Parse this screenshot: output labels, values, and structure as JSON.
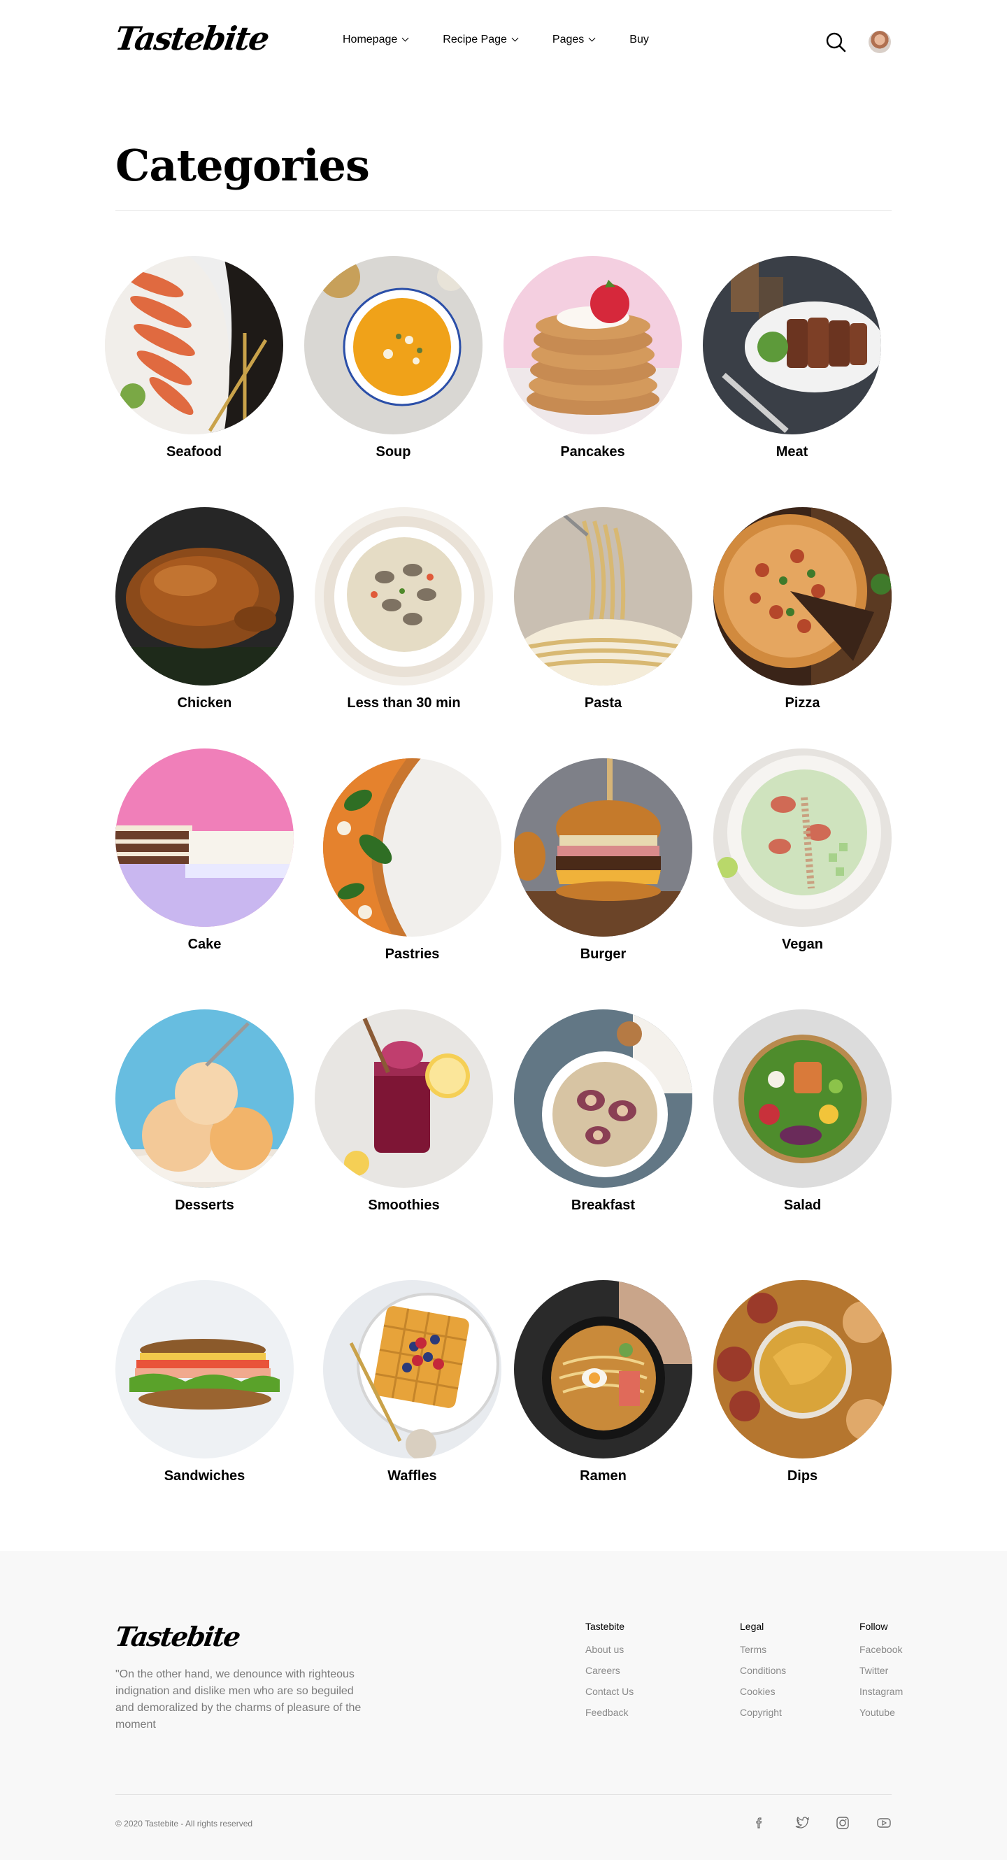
{
  "header": {
    "logo": "Tastebite",
    "nav": [
      {
        "label": "Homepage",
        "has_dropdown": true
      },
      {
        "label": "Recipe Page",
        "has_dropdown": true
      },
      {
        "label": "Pages",
        "has_dropdown": true
      },
      {
        "label": "Buy",
        "has_dropdown": false
      }
    ],
    "search_icon": "search-icon",
    "avatar": "user-avatar"
  },
  "page": {
    "title": "Categories"
  },
  "categories": [
    {
      "label": "Seafood",
      "image": "seafood-photo"
    },
    {
      "label": "Soup",
      "image": "soup-photo"
    },
    {
      "label": "Pancakes",
      "image": "pancakes-photo"
    },
    {
      "label": "Meat",
      "image": "meat-photo"
    },
    {
      "label": "Chicken",
      "image": "chicken-photo"
    },
    {
      "label": "Less than 30 min",
      "image": "quick-meal-photo"
    },
    {
      "label": "Pasta",
      "image": "pasta-photo"
    },
    {
      "label": "Pizza",
      "image": "pizza-photo"
    },
    {
      "label": "Cake",
      "image": "cake-photo"
    },
    {
      "label": "Pastries",
      "image": "pastries-photo"
    },
    {
      "label": "Burger",
      "image": "burger-photo"
    },
    {
      "label": "Vegan",
      "image": "vegan-photo"
    },
    {
      "label": "Desserts",
      "image": "desserts-photo"
    },
    {
      "label": "Smoothies",
      "image": "smoothies-photo"
    },
    {
      "label": "Breakfast",
      "image": "breakfast-photo"
    },
    {
      "label": "Salad",
      "image": "salad-photo"
    },
    {
      "label": "Sandwiches",
      "image": "sandwiches-photo"
    },
    {
      "label": "Waffles",
      "image": "waffles-photo"
    },
    {
      "label": "Ramen",
      "image": "ramen-photo"
    },
    {
      "label": "Dips",
      "image": "dips-photo"
    }
  ],
  "footer": {
    "logo": "Tastebite",
    "quote": "\"On the other hand, we denounce with righteous indignation and dislike men who are so beguiled and demoralized by the charms of pleasure of the moment",
    "columns": [
      {
        "title": "Tastebite",
        "links": [
          "About us",
          "Careers",
          "Contact Us",
          "Feedback"
        ]
      },
      {
        "title": "Legal",
        "links": [
          "Terms",
          "Conditions",
          "Cookies",
          "Copyright"
        ]
      },
      {
        "title": "Follow",
        "links": [
          "Facebook",
          "Twitter",
          "Instagram",
          "Youtube"
        ]
      }
    ],
    "copyright": "© 2020 Tastebite - All rights reserved",
    "social_icons": [
      "facebook-icon",
      "twitter-icon",
      "instagram-icon",
      "youtube-icon"
    ]
  },
  "colors": {
    "background": "#ffffff",
    "footer_background": "#f8f8f8",
    "muted_text": "#7a7a7a",
    "divider": "#e5e5e5"
  }
}
